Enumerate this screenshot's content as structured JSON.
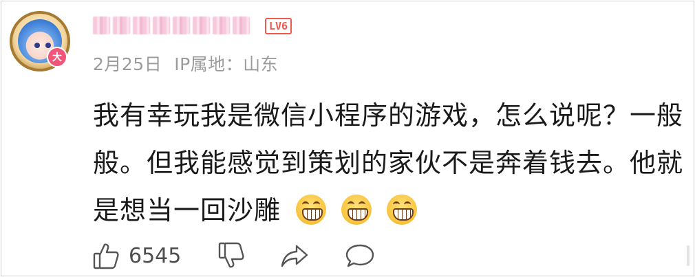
{
  "user": {
    "name": "",
    "level": "LV6",
    "avatar_badge": "大",
    "date": "2月25日",
    "ip_location": "IP属地：山东"
  },
  "comment": {
    "lines": [
      "我有幸玩我是微信小程序的游戏，怎么说呢？一般",
      "般。但我能感觉到策划的家伙不是奔着钱去。他就",
      "是想当一回沙雕"
    ],
    "emoji_icons": [
      "grin-emoji",
      "grin-emoji",
      "grin-emoji"
    ]
  },
  "actions": {
    "like_count": "6545",
    "icons": [
      "thumbs-up-icon",
      "thumbs-down-icon",
      "share-icon",
      "comment-icon"
    ]
  },
  "colors": {
    "level_red": "#ee5a4f",
    "meta_gray": "#9b9b9b",
    "text": "#1a1a1a"
  }
}
